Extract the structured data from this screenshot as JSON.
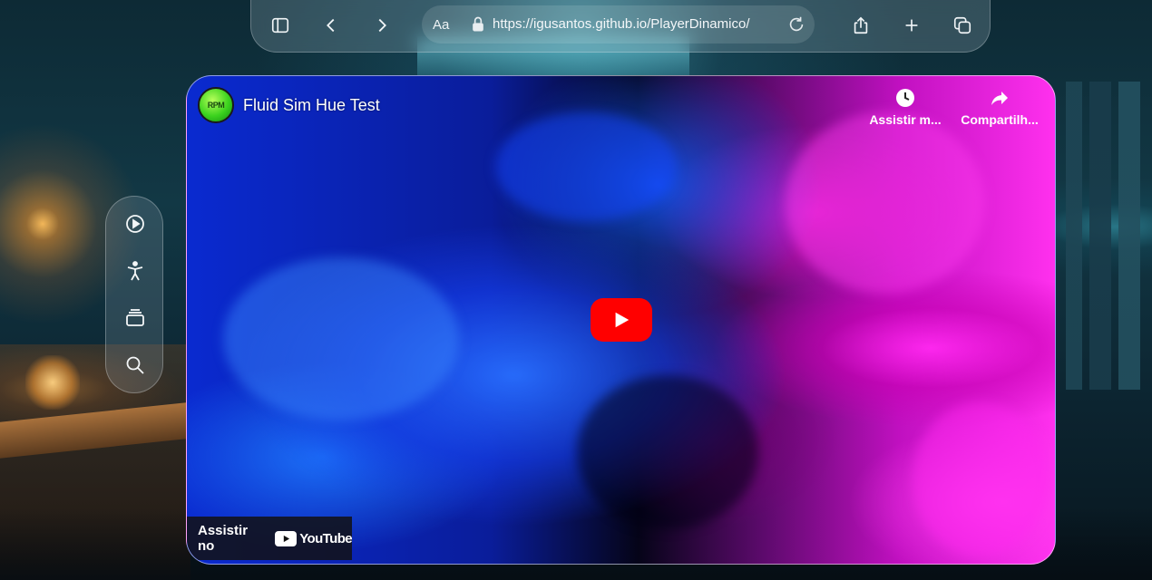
{
  "browser": {
    "text_size_label": "Aa",
    "url": "https://igusantos.github.io/PlayerDinamico/",
    "buttons": [
      "sidebar-toggle",
      "back",
      "forward",
      "reload",
      "share",
      "new-tab",
      "tabs-overview"
    ]
  },
  "side_toolbar": {
    "icons": [
      "play-circle-icon",
      "accessibility-icon",
      "stack-icon",
      "search-icon"
    ]
  },
  "video": {
    "channel_avatar_text": "RPM",
    "title": "Fluid Sim Hue Test",
    "actions": {
      "watch_later_label": "Assistir m...",
      "share_label": "Compartilh..."
    },
    "watch_on_label": "Assistir no",
    "youtube_wordmark": "YouTube"
  },
  "colors": {
    "play_button": "#ff0000",
    "fluid_blue": "#1e50ff",
    "fluid_magenta": "#ff30ee"
  }
}
